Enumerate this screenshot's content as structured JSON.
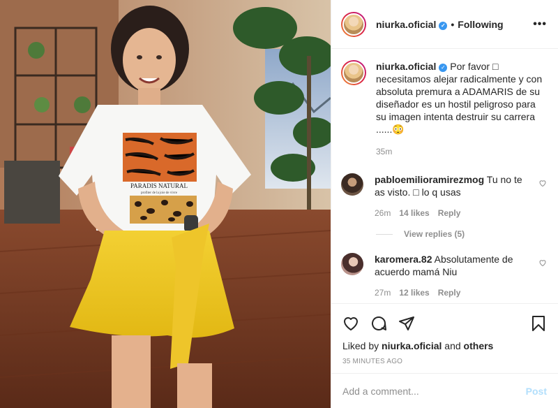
{
  "header": {
    "username": "niurka.oficial",
    "verified_mark": "✓",
    "separator": "•",
    "follow_status": "Following",
    "more_label": "•••"
  },
  "caption": {
    "username": "niurka.oficial",
    "text": "Por favor □ necesitamos alejar radicalmente y con absoluta premura a ADAMARIS de su diseñador es un hostil peligroso para su imagen intenta destruir su carrera ......😳",
    "time": "35m"
  },
  "comments": [
    {
      "username": "pabloemilioramirezmog",
      "text": "Tu no te as visto. □ lo q usas",
      "time": "26m",
      "likes": "14 likes",
      "reply": "Reply",
      "view_replies": "View replies (5)"
    },
    {
      "username": "karomera.82",
      "text": "Absolutamente de acuerdo mamá Niu",
      "time": "27m",
      "likes": "12 likes",
      "reply": "Reply"
    }
  ],
  "actions": {
    "liked_prefix": "Liked by",
    "liked_user": "niurka.oficial",
    "liked_and": "and",
    "liked_others": "others",
    "timestamp": "35 MINUTES AGO"
  },
  "add_comment": {
    "placeholder": "Add a comment...",
    "post_label": "Post"
  },
  "icons": {
    "like": "heart-icon",
    "comment": "comment-icon",
    "share": "share-icon",
    "save": "bookmark-icon",
    "comment_like": "heart-icon"
  },
  "colors": {
    "verified": "#3897f0",
    "post_disabled": "#b2dffc",
    "muted": "#8e8e8e",
    "text": "#262626"
  },
  "photo": {
    "shirt_text": "PARADIS NATURAL",
    "shirt_subtext": "profiter de la joie de vivre"
  }
}
